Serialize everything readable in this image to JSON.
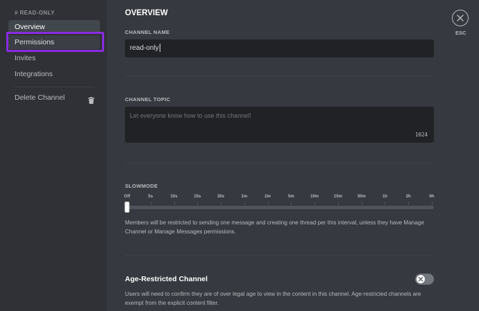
{
  "sidebar": {
    "header": "# READ-ONLY",
    "items": [
      {
        "label": "Overview"
      },
      {
        "label": "Permissions"
      },
      {
        "label": "Invites"
      },
      {
        "label": "Integrations"
      },
      {
        "label": "Delete Channel"
      }
    ],
    "icons": {
      "delete": "trash-icon"
    },
    "highlight_color": "#8a2be2"
  },
  "main": {
    "title": "OVERVIEW",
    "channel_name": {
      "label": "CHANNEL NAME",
      "value": "read-only"
    },
    "channel_topic": {
      "label": "CHANNEL TOPIC",
      "placeholder": "Let everyone know how to use this channel!",
      "value": "",
      "char_count": "1024"
    },
    "slowmode": {
      "label": "SLOWMODE",
      "ticks": [
        "Off",
        "5s",
        "10s",
        "15s",
        "30s",
        "1m",
        "2m",
        "5m",
        "10m",
        "15m",
        "30m",
        "1h",
        "2h",
        "6h"
      ],
      "selected": "Off",
      "selected_index": 0,
      "description": "Members will be restricted to sending one message and creating one thread per this interval, unless they have Manage Channel or Manage Messages permissions."
    },
    "age_restricted": {
      "title": "Age-Restricted Channel",
      "enabled": false,
      "description": "Users will need to confirm they are of over legal age to view in the content in this channel. Age-restricted channels are exempt from the explicit content filter."
    }
  },
  "close": {
    "label": "ESC",
    "icon": "close-icon"
  }
}
